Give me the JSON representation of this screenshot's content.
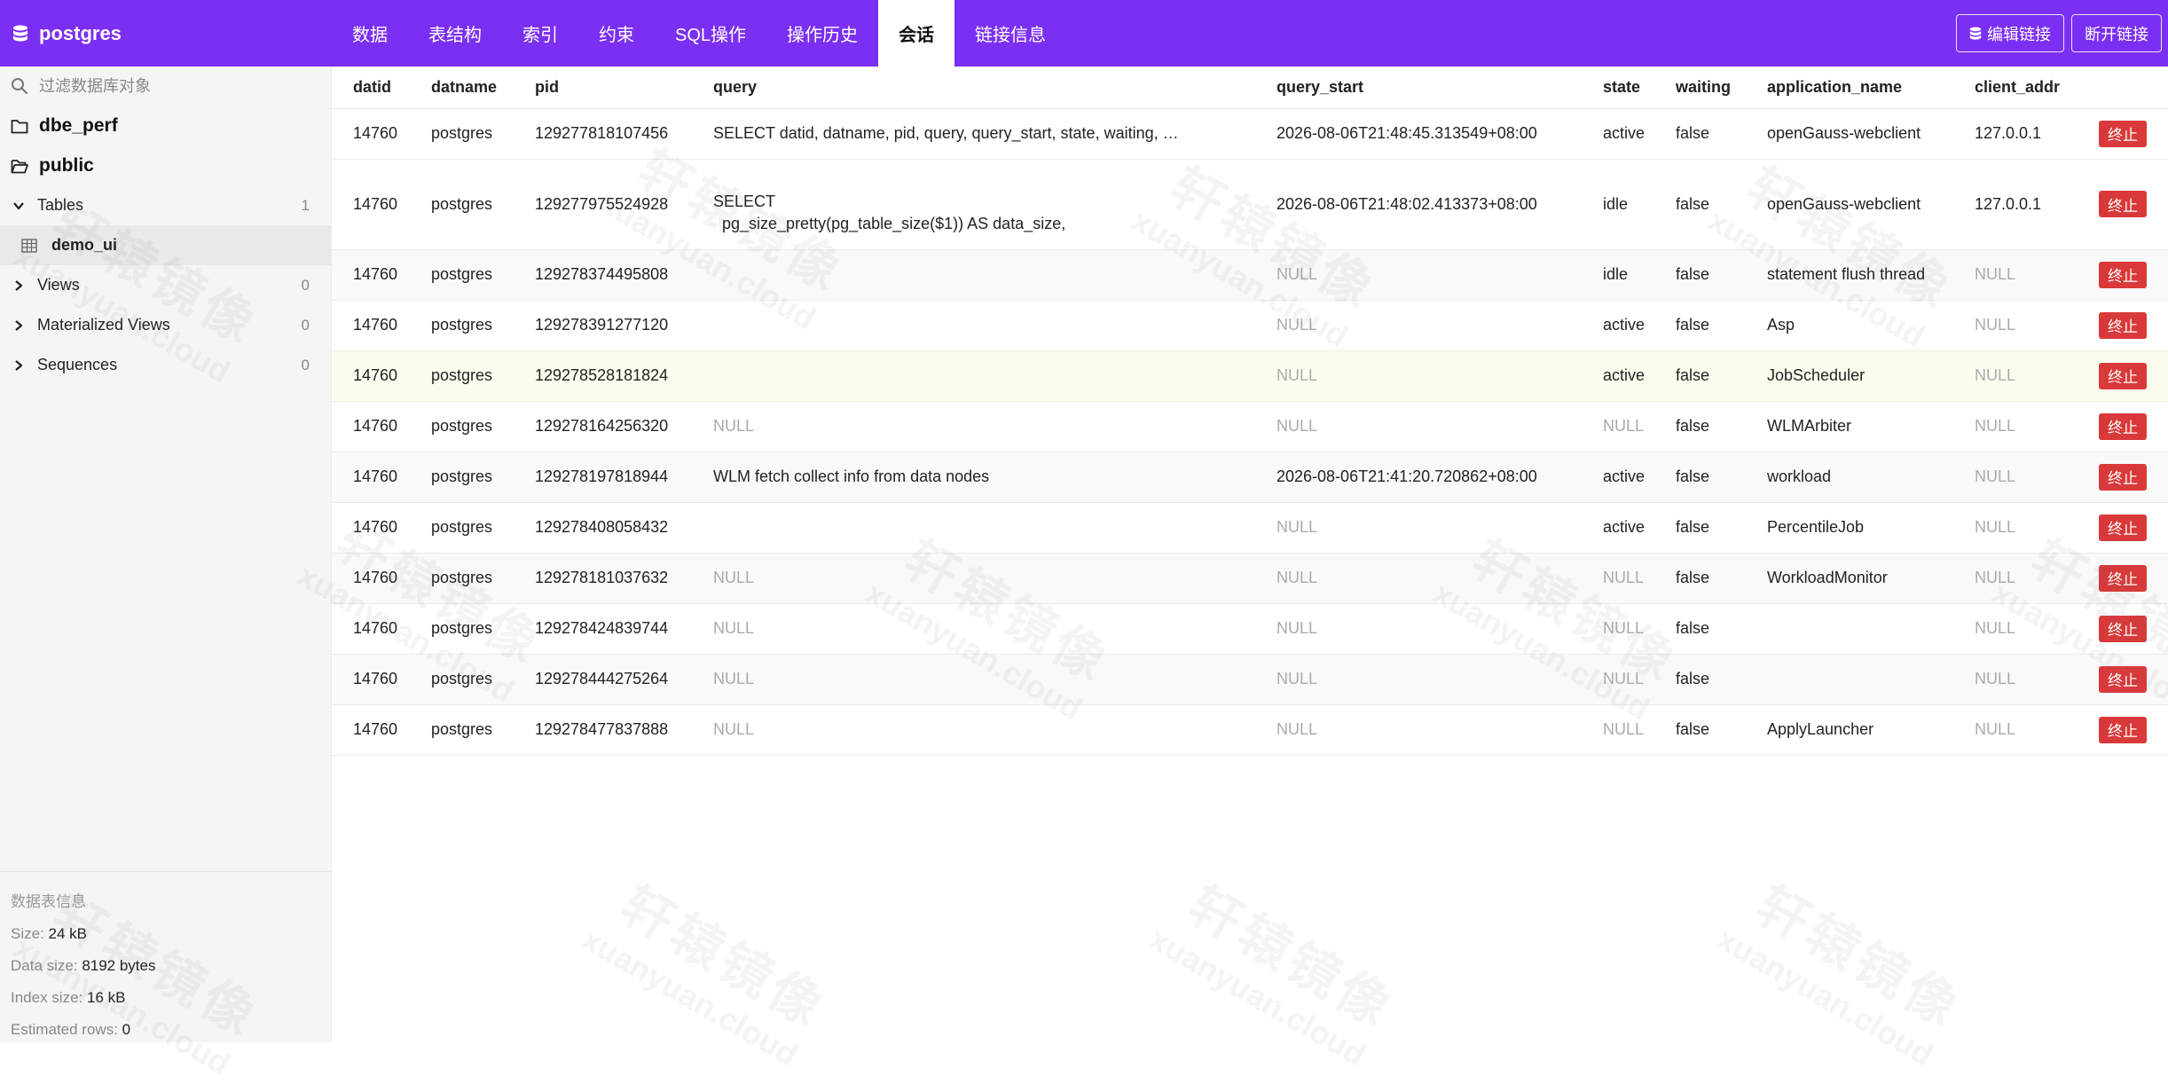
{
  "app": {
    "db_name": "postgres"
  },
  "tabs": [
    {
      "label": "数据"
    },
    {
      "label": "表结构"
    },
    {
      "label": "索引"
    },
    {
      "label": "约束"
    },
    {
      "label": "SQL操作"
    },
    {
      "label": "操作历史"
    },
    {
      "label": "会话",
      "active": true
    },
    {
      "label": "链接信息"
    }
  ],
  "top_actions": {
    "edit_label": "编辑链接",
    "disconnect_label": "断开链接"
  },
  "sidebar": {
    "search_placeholder": "过滤数据库对象",
    "schemas": [
      {
        "name": "dbe_perf",
        "icon": "folder-icon"
      },
      {
        "name": "public",
        "icon": "folder-open-icon"
      }
    ],
    "tables_label": "Tables",
    "tables_count": "1",
    "table_item": "demo_ui",
    "views_label": "Views",
    "views_count": "0",
    "mviews_label": "Materialized Views",
    "mviews_count": "0",
    "sequences_label": "Sequences",
    "sequences_count": "0",
    "info": {
      "title": "数据表信息",
      "size_label": "Size: ",
      "size_value": "24 kB",
      "data_size_label": "Data size: ",
      "data_size_value": "8192 bytes",
      "index_size_label": "Index size: ",
      "index_size_value": "16 kB",
      "rows_label": "Estimated rows: ",
      "rows_value": "0"
    }
  },
  "sessions": {
    "columns": [
      "datid",
      "datname",
      "pid",
      "query",
      "query_start",
      "state",
      "waiting",
      "application_name",
      "client_addr"
    ],
    "kill_label": "终止",
    "rows": [
      {
        "datid": "14760",
        "datname": "postgres",
        "pid": "129277818107456",
        "query": "SELECT datid, datname, pid, query, query_start, state, waiting, …",
        "query_start": "2026-08-06T21:48:45.313549+08:00",
        "state": "active",
        "waiting": "false",
        "application_name": "openGauss-webclient",
        "client_addr": "127.0.0.1"
      },
      {
        "datid": "14760",
        "datname": "postgres",
        "pid": "129277975524928",
        "query": "SELECT\n  pg_size_pretty(pg_table_size($1)) AS data_size,",
        "query_start": "2026-08-06T21:48:02.413373+08:00",
        "state": "idle",
        "waiting": "false",
        "application_name": "openGauss-webclient",
        "client_addr": "127.0.0.1"
      },
      {
        "datid": "14760",
        "datname": "postgres",
        "pid": "129278374495808",
        "query": "",
        "query_start": "NULL",
        "state": "idle",
        "waiting": "false",
        "application_name": "statement flush thread",
        "client_addr": "NULL"
      },
      {
        "datid": "14760",
        "datname": "postgres",
        "pid": "129278391277120",
        "query": "",
        "query_start": "NULL",
        "state": "active",
        "waiting": "false",
        "application_name": "Asp",
        "client_addr": "NULL"
      },
      {
        "datid": "14760",
        "datname": "postgres",
        "pid": "129278528181824",
        "query": "",
        "query_start": "NULL",
        "state": "active",
        "waiting": "false",
        "application_name": "JobScheduler",
        "client_addr": "NULL"
      },
      {
        "datid": "14760",
        "datname": "postgres",
        "pid": "129278164256320",
        "query": "NULL",
        "query_start": "NULL",
        "state": "NULL",
        "waiting": "false",
        "application_name": "WLMArbiter",
        "client_addr": "NULL"
      },
      {
        "datid": "14760",
        "datname": "postgres",
        "pid": "129278197818944",
        "query": "WLM fetch collect info from data nodes",
        "query_start": "2026-08-06T21:41:20.720862+08:00",
        "state": "active",
        "waiting": "false",
        "application_name": "workload",
        "client_addr": "NULL"
      },
      {
        "datid": "14760",
        "datname": "postgres",
        "pid": "129278408058432",
        "query": "",
        "query_start": "NULL",
        "state": "active",
        "waiting": "false",
        "application_name": "PercentileJob",
        "client_addr": "NULL"
      },
      {
        "datid": "14760",
        "datname": "postgres",
        "pid": "129278181037632",
        "query": "NULL",
        "query_start": "NULL",
        "state": "NULL",
        "waiting": "false",
        "application_name": "WorkloadMonitor",
        "client_addr": "NULL"
      },
      {
        "datid": "14760",
        "datname": "postgres",
        "pid": "129278424839744",
        "query": "NULL",
        "query_start": "NULL",
        "state": "NULL",
        "waiting": "false",
        "application_name": "",
        "client_addr": "NULL"
      },
      {
        "datid": "14760",
        "datname": "postgres",
        "pid": "129278444275264",
        "query": "NULL",
        "query_start": "NULL",
        "state": "NULL",
        "waiting": "false",
        "application_name": "",
        "client_addr": "NULL"
      },
      {
        "datid": "14760",
        "datname": "postgres",
        "pid": "129278477837888",
        "query": "NULL",
        "query_start": "NULL",
        "state": "NULL",
        "waiting": "false",
        "application_name": "ApplyLauncher",
        "client_addr": "NULL"
      }
    ]
  },
  "watermark": {
    "cn": "轩辕镜像",
    "en": "xuanyuan.cloud"
  },
  "colors": {
    "brand": "#7b2ff2",
    "danger": "#d9393a"
  }
}
